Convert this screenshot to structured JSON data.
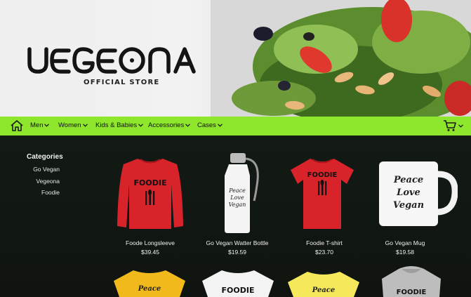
{
  "brand": {
    "name": "VEGEONA",
    "subtitle": "OFFICIAL STORE"
  },
  "colors": {
    "accent": "#8ee62d",
    "background": "#111611",
    "text": "#f0f0f0"
  },
  "nav": {
    "home_icon": "home-icon",
    "items": [
      {
        "label": "Men"
      },
      {
        "label": "Women"
      },
      {
        "label": "Kids & Babies"
      },
      {
        "label": "Accessories"
      },
      {
        "label": "Cases"
      }
    ],
    "cart_icon": "cart-icon"
  },
  "sidebar": {
    "title": "Categories",
    "items": [
      {
        "label": "Go Vegan"
      },
      {
        "label": "Vegeona"
      },
      {
        "label": "Foodie"
      }
    ]
  },
  "products": [
    {
      "name": "Foode Longsleeve",
      "price": "$39.45",
      "print": "FOODIE"
    },
    {
      "name": "Go Vegan Watter Bottle",
      "price": "$19.59",
      "print": "Peace Love Vegan"
    },
    {
      "name": "Foodie T-shirt",
      "price": "$23.70",
      "print": "FOODIE"
    },
    {
      "name": "Go Vegan Mug",
      "price": "$19.58",
      "print": "Peace Love Vegan"
    }
  ],
  "second_row_prints": [
    "Peace",
    "FOODIE",
    "Peace",
    "FOODIE"
  ]
}
